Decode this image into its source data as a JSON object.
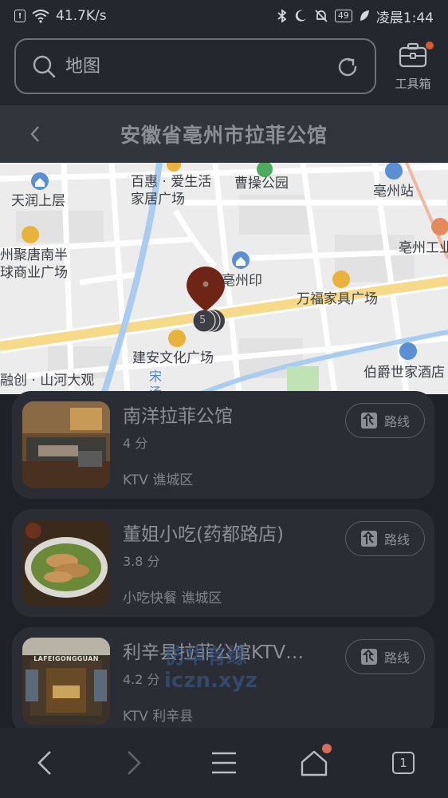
{
  "status_bar": {
    "net_speed": "41.7K/s",
    "battery": "49",
    "time": "凌晨1:44"
  },
  "search": {
    "placeholder": "地图"
  },
  "toolbox": {
    "label": "工具箱"
  },
  "titlebar": {
    "title": "安徽省亳州市拉菲公馆"
  },
  "map": {
    "pois": [
      {
        "id": "baihui",
        "text": "百惠 · 爱生活\n家居广场"
      },
      {
        "id": "caocao",
        "text": "曹操公园"
      },
      {
        "id": "tianrun",
        "text": "天润上层"
      },
      {
        "id": "bozhou_station",
        "text": "亳州站"
      },
      {
        "id": "jutang",
        "text": "州聚唐南半\n球商业广场"
      },
      {
        "id": "bozhou_gongye",
        "text": "亳州工业"
      },
      {
        "id": "bozhouyin",
        "text": "亳州印"
      },
      {
        "id": "wanfu",
        "text": "万福家具广场"
      },
      {
        "id": "jianan",
        "text": "建安文化广场"
      },
      {
        "id": "bojue",
        "text": "伯爵世家酒店"
      },
      {
        "id": "rongchuang",
        "text": "融创 · 山河大观"
      }
    ],
    "river_label": "宋汤河",
    "cluster_count": "5",
    "marker_color": "#6e2516"
  },
  "results": [
    {
      "name": "南洋拉菲公馆",
      "score": "4 分",
      "category": "KTV 谯城区",
      "route_label": "路线"
    },
    {
      "name": "董姐小吃(药都路店)",
      "score": "3.8 分",
      "category": "小吃快餐 谯城区",
      "route_label": "路线"
    },
    {
      "name": "利辛县拉菲公馆KTV…",
      "score": "4.2 分",
      "category": "KTV 利辛县",
      "route_label": "路线"
    }
  ],
  "thumb_sign": "LAFEIGONGGUAN",
  "watermark": {
    "line1": "仿华有缘",
    "line2": "iczn.xyz"
  },
  "bottom_nav": {
    "tab_count": "1"
  },
  "colors": {
    "background": "#1e2127",
    "card": "#2a2d33",
    "accent_dot": "#d95a31",
    "map_road_highlight": "#f7d98a",
    "map_water": "#a9cdf0"
  }
}
